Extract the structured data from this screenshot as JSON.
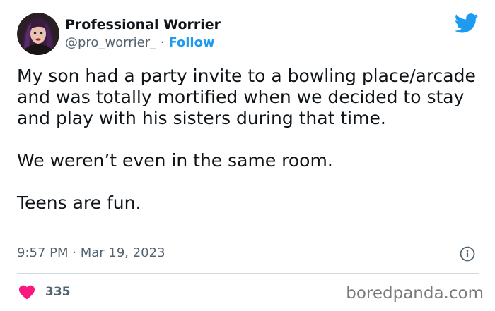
{
  "author": {
    "display_name": "Professional Worrier",
    "handle": "@pro_worrier_",
    "separator": " · ",
    "follow_label": "Follow"
  },
  "tweet": {
    "paragraphs": [
      "My son had a party invite to a bowling place/arcade and was totally mortified when we decided to stay and play with his sisters during that time.",
      "We weren’t even in the same room.",
      "Teens are fun."
    ],
    "time": "9:57 PM",
    "date_separator": " · ",
    "date": "Mar 19, 2023"
  },
  "engagement": {
    "likes": "335"
  },
  "watermark": "boredpanda.com",
  "icons": {
    "brand": "twitter-bird-icon",
    "info": "info-icon",
    "like": "heart-icon"
  },
  "colors": {
    "twitter_blue": "#1d9bf0",
    "heart": "#f91880",
    "text": "#0f1419",
    "secondary": "#536471",
    "divider": "#cfd9de"
  }
}
